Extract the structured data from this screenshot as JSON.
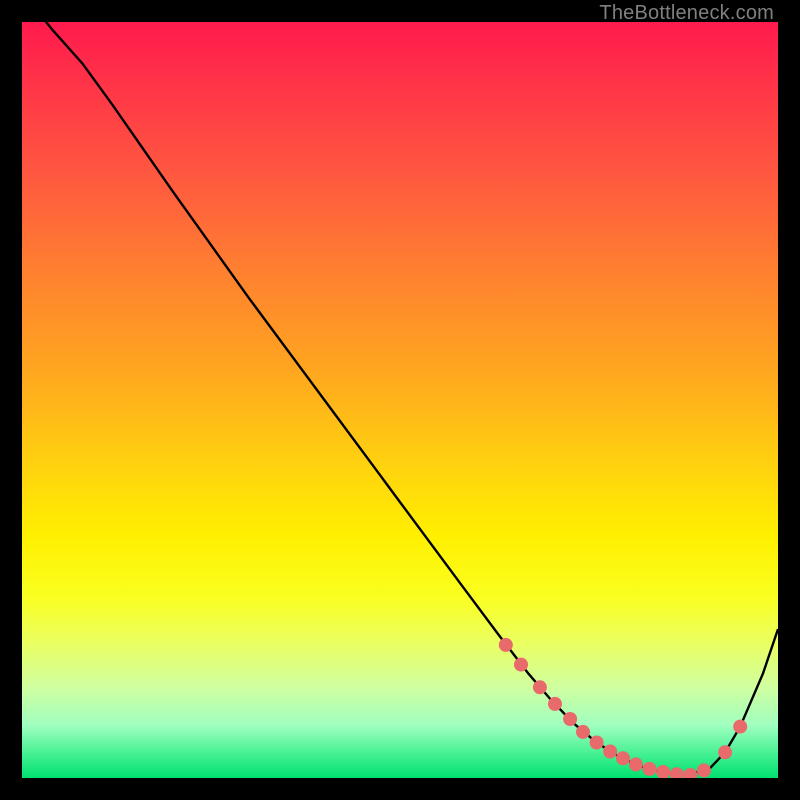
{
  "attribution": "TheBottleneck.com",
  "colors": {
    "page_bg": "#000000",
    "curve": "#000000",
    "marker_fill": "#e86a6a",
    "marker_stroke": "#c74444"
  },
  "chart_data": {
    "type": "line",
    "title": "",
    "xlabel": "",
    "ylabel": "",
    "xlim": [
      0,
      100
    ],
    "ylim": [
      0,
      100
    ],
    "series": [
      {
        "name": "curve",
        "x": [
          0,
          4,
          8,
          12,
          20,
          30,
          40,
          50,
          58,
          63,
          67,
          70,
          73,
          76,
          79,
          82,
          85,
          88,
          91,
          93,
          95,
          98,
          100
        ],
        "y": [
          104,
          99,
          94.5,
          89,
          77.5,
          63.5,
          50,
          36.5,
          25.7,
          19,
          13.8,
          10.3,
          7.2,
          4.7,
          2.8,
          1.5,
          0.7,
          0.4,
          1.3,
          3.4,
          6.8,
          13.8,
          19.7
        ]
      }
    ],
    "markers": {
      "name": "highlight-dots",
      "x": [
        64,
        66,
        68.5,
        70.5,
        72.5,
        74.2,
        76,
        77.8,
        79.5,
        81.2,
        83,
        84.8,
        86.6,
        88.4,
        90.2,
        93,
        95
      ],
      "y": [
        17.6,
        15,
        12,
        9.8,
        7.8,
        6.1,
        4.7,
        3.5,
        2.6,
        1.8,
        1.2,
        0.8,
        0.5,
        0.4,
        1.0,
        3.4,
        6.8
      ]
    }
  }
}
